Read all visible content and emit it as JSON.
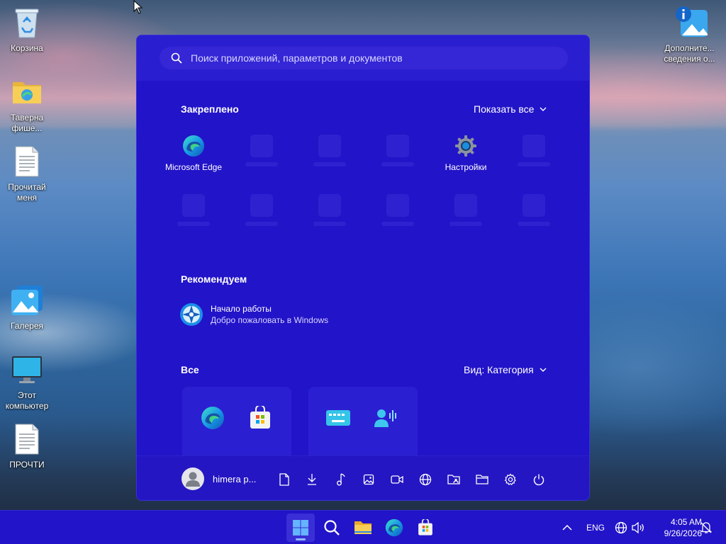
{
  "desktop": {
    "icons": [
      {
        "label": "Корзина",
        "icon": "recycle-bin-icon"
      },
      {
        "label": "Таверна фише...",
        "icon": "folder-icon"
      },
      {
        "label": "Прочитай меня",
        "icon": "text-file-icon"
      },
      {
        "label": "Галерея",
        "icon": "gallery-icon"
      },
      {
        "label": "Этот компьютер",
        "icon": "monitor-icon"
      },
      {
        "label": "ПРОЧТИ",
        "icon": "text-file-icon"
      },
      {
        "label": "Дополните... сведения о...",
        "icon": "info-icon"
      }
    ]
  },
  "start_menu": {
    "search": {
      "placeholder": "Поиск приложений, параметров и документов"
    },
    "pinned": {
      "title": "Закреплено",
      "show_all": "Показать все",
      "apps": [
        {
          "label": "Microsoft Edge",
          "icon": "edge-icon"
        },
        {
          "label": "Настройки",
          "icon": "settings-gear-icon"
        }
      ]
    },
    "recommended": {
      "title": "Рекомендуем",
      "item": {
        "title": "Начало работы",
        "subtitle": "Добро пожаловать в Windows",
        "icon": "get-started-icon"
      }
    },
    "all_apps": {
      "title": "Все",
      "view_label": "Вид: Категория"
    },
    "footer": {
      "user_name": "himera p...",
      "buttons": [
        "documents-icon",
        "downloads-icon",
        "music-icon",
        "pictures-icon",
        "videos-icon",
        "network-icon",
        "personal-folder-icon",
        "file-explorer-icon",
        "settings-icon",
        "power-icon"
      ]
    }
  },
  "taskbar": {
    "apps": [
      "start-icon",
      "search-icon",
      "file-explorer-icon",
      "edge-icon",
      "store-icon"
    ],
    "tray": {
      "language": "ENG",
      "time": "4:05 AM",
      "date": "9/26/2026"
    }
  },
  "colors": {
    "start_bg": "#2214c8",
    "taskbar_bg": "#2214c8",
    "accent": "#2a1fd0"
  }
}
